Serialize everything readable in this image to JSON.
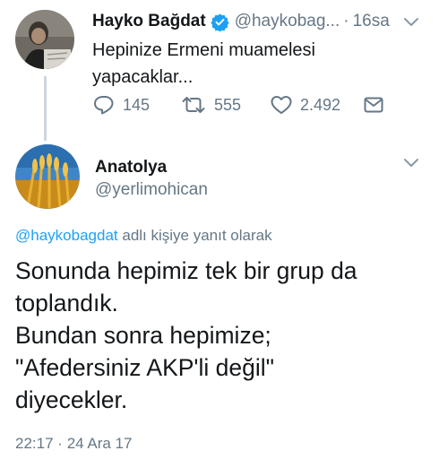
{
  "tweet1": {
    "author_name": "Hayko Bağdat",
    "handle": "@haykobag...",
    "separator": "·",
    "time": "16sa",
    "text": "Hepinize Ermeni muamelesi yapacaklar...",
    "actions": {
      "replies": "145",
      "retweets": "555",
      "likes": "2.492"
    },
    "icons": [
      "reply-icon",
      "retweet-icon",
      "like-icon",
      "direct-message-icon",
      "verified-badge-icon",
      "chevron-down-icon"
    ]
  },
  "tweet2": {
    "author_name": "Anatolya",
    "handle": "@yerlimohican",
    "reply_to_mention": "@haykobagdat",
    "reply_to_suffix": "adlı kişiye yanıt olarak",
    "text_lines": [
      "Sonunda hepimiz tek bir grup da",
      "toplandık.",
      "Bundan sonra hepimize;",
      "\"Afedersiniz AKP'li değil\"",
      "diyecekler."
    ],
    "time": "22:17",
    "separator": "·",
    "date": "24 Ara 17"
  },
  "colors": {
    "text": "#14171a",
    "secondary": "#657786",
    "link": "#1da1f2",
    "verified": "#1da1f2",
    "thread_line": "#cdd6dd"
  }
}
